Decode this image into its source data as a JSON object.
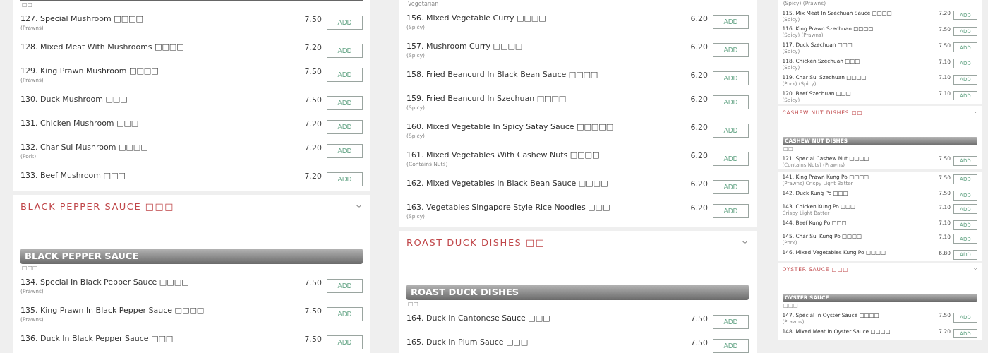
{
  "columns": [
    {
      "blocks": [
        {
          "kind": "continued",
          "note": "□□",
          "items": [
            {
              "name": "127. Special Mushroom □□□□",
              "sub": "(Prawns)",
              "price": "7.50",
              "button": "ADD"
            },
            {
              "name": "128. Mixed Meat With Mushrooms □□□□",
              "price": "7.20",
              "button": "ADD"
            },
            {
              "name": "129. King Prawn Mushroom □□□□",
              "sub": "(Prawns)",
              "price": "7.50",
              "button": "ADD"
            },
            {
              "name": "130. Duck Mushroom □□□",
              "price": "7.50",
              "button": "ADD"
            },
            {
              "name": "131. Chicken Mushroom □□□",
              "price": "7.20",
              "button": "ADD"
            },
            {
              "name": "132. Char Sui Mushroom □□□□",
              "sub": "(Pork)",
              "price": "7.20",
              "button": "ADD"
            },
            {
              "name": "133. Beef Mushroom □□□",
              "price": "7.20",
              "button": "ADD"
            }
          ]
        },
        {
          "kind": "section",
          "heading": "BLACK PEPPER SAUCE □□□",
          "banner": "BLACK PEPPER SAUCE",
          "note": "□□□",
          "items": [
            {
              "name": "134. Special In Black Pepper Sauce □□□□",
              "sub": "(Prawns)",
              "price": "7.50",
              "button": "ADD"
            },
            {
              "name": "135. King Prawn In Black Pepper Sauce □□□□",
              "sub": "(Prawns)",
              "price": "7.50",
              "button": "ADD"
            },
            {
              "name": "136. Duck In Black Pepper Sauce □□□",
              "price": "7.50",
              "button": "ADD"
            }
          ]
        }
      ]
    },
    {
      "blocks": [
        {
          "kind": "items",
          "note": "Vegetarian",
          "items": [
            {
              "name": "156. Mixed Vegetable Curry □□□□",
              "sub": "(Spicy)",
              "price": "6.20",
              "button": "ADD"
            },
            {
              "name": "157. Mushroom Curry □□□□",
              "sub": "(Spicy)",
              "price": "6.20",
              "button": "ADD"
            },
            {
              "name": "158. Fried Beancurd In Black Bean Sauce □□□□",
              "price": "6.20",
              "button": "ADD"
            },
            {
              "name": "159. Fried Beancurd In Szechuan □□□□",
              "sub": "(Spicy)",
              "price": "6.20",
              "button": "ADD"
            },
            {
              "name": "160. Mixed Vegetable In Spicy Satay Sauce □□□□□",
              "sub": "(Spicy)",
              "price": "6.20",
              "button": "ADD"
            },
            {
              "name": "161. Mixed Vegetables With Cashew Nuts □□□□",
              "sub": "(Contains Nuts)",
              "price": "6.20",
              "button": "ADD"
            },
            {
              "name": "162. Mixed Vegetables In Black Bean Sauce □□□□",
              "price": "6.20",
              "button": "ADD"
            },
            {
              "name": "163. Vegetables Singapore Style Rice Noodles □□□",
              "sub": "(Spicy)",
              "price": "6.20",
              "button": "ADD"
            }
          ]
        },
        {
          "kind": "section",
          "heading": "ROAST DUCK DISHES □□",
          "banner": "ROAST DUCK DISHES",
          "note": "□□",
          "items": [
            {
              "name": "164. Duck In Cantonese Sauce □□□",
              "price": "7.50",
              "button": "ADD"
            },
            {
              "name": "165. Duck In Plum Sauce □□□",
              "price": "7.50",
              "button": "ADD"
            }
          ]
        }
      ]
    },
    {
      "blocks": [
        {
          "kind": "items",
          "note": "(Spicy) (Prawns)",
          "items": [
            {
              "name": "115. Mix Meat In Szechuan Sauce □□□□",
              "sub": "(Spicy)",
              "price": "7.20",
              "button": "ADD"
            },
            {
              "name": "116. King Prawn Szechuan □□□□",
              "sub": "(Spicy) (Prawns)",
              "price": "7.50",
              "button": "ADD"
            },
            {
              "name": "117. Duck Szechuan □□□",
              "sub": "(Spicy)",
              "price": "7.50",
              "button": "ADD"
            },
            {
              "name": "118. Chicken Szechuan □□□",
              "sub": "(Spicy)",
              "price": "7.10",
              "button": "ADD"
            },
            {
              "name": "119. Char Sui Szechuan □□□□",
              "sub": "(Pork) (Spicy)",
              "price": "7.10",
              "button": "ADD"
            },
            {
              "name": "120. Beef Szechuan □□□",
              "sub": "(Spicy)",
              "price": "7.10",
              "button": "ADD"
            }
          ]
        },
        {
          "kind": "section",
          "heading": "CASHEW NUT DISHES □□",
          "banner": "CASHEW NUT DISHES",
          "note": "□□",
          "items": [
            {
              "name": "121. Special Cashew Nut □□□□",
              "sub": "(Contains Nuts) (Prawns)",
              "price": "7.50",
              "button": "ADD"
            }
          ]
        },
        {
          "kind": "items",
          "items": [
            {
              "name": "141. King Prawn Kung Po □□□□",
              "sub": "(Prawns) Crispy Light Batter",
              "price": "7.50",
              "button": "ADD"
            },
            {
              "name": "142. Duck Kung Po □□□",
              "price": "7.50",
              "button": "ADD"
            },
            {
              "name": "143. Chicken Kung Po □□□",
              "sub": "Crispy Light Batter",
              "price": "7.10",
              "button": "ADD"
            },
            {
              "name": "144. Beef Kung Po □□□",
              "price": "7.10",
              "button": "ADD"
            },
            {
              "name": "145. Char Sui Kung Po □□□□",
              "sub": "(Pork)",
              "price": "7.10",
              "button": "ADD"
            },
            {
              "name": "146. Mixed Vegetables Kung Po □□□□",
              "price": "6.80",
              "button": "ADD"
            }
          ]
        },
        {
          "kind": "section",
          "heading": "OYSTER SAUCE □□□",
          "banner": "OYSTER SAUCE",
          "note": "□□□",
          "items": [
            {
              "name": "147. Special In Oyster Sauce □□□□",
              "sub": "(Prawns)",
              "price": "7.50",
              "button": "ADD"
            },
            {
              "name": "148. Mixed Meat In Oyster Sauce □□□□",
              "price": "7.20",
              "button": "ADD"
            }
          ]
        }
      ]
    }
  ]
}
